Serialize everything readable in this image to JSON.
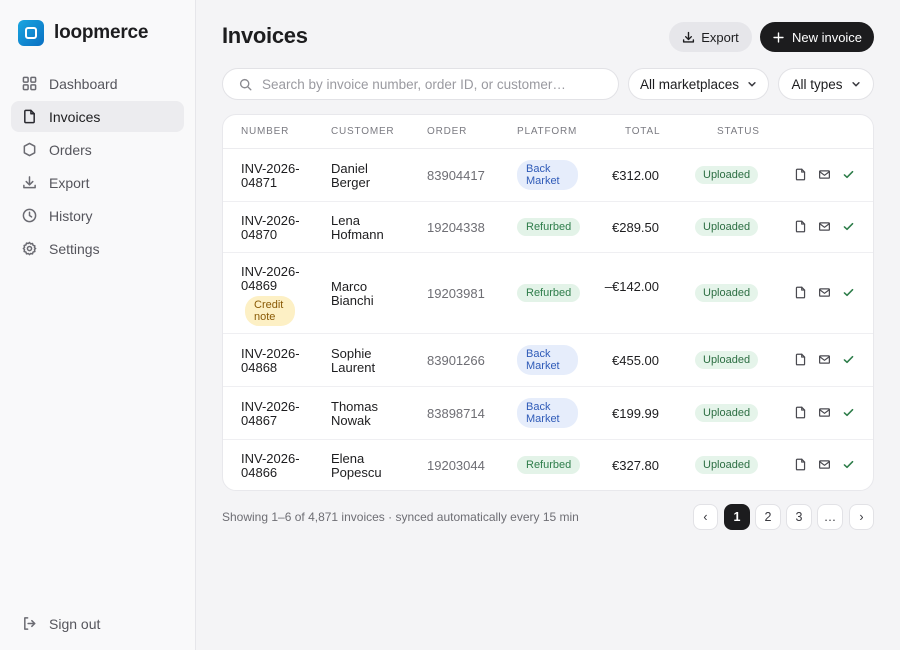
{
  "brand": {
    "name": "loopmerce",
    "logo_icon": "square-logo-icon",
    "logo_color": "#0a8fd6"
  },
  "sidebar": {
    "items": [
      {
        "label": "Dashboard",
        "icon": "grid-icon",
        "active": false
      },
      {
        "label": "Invoices",
        "icon": "file-icon",
        "active": true
      },
      {
        "label": "Orders",
        "icon": "box-icon",
        "active": false
      },
      {
        "label": "Export",
        "icon": "download-icon",
        "active": false
      },
      {
        "label": "History",
        "icon": "clock-icon",
        "active": false
      },
      {
        "label": "Settings",
        "icon": "gear-icon",
        "active": false
      }
    ],
    "signout_label": "Sign out"
  },
  "header": {
    "title": "Invoices",
    "export_label": "Export",
    "new_invoice_label": "New invoice"
  },
  "filters": {
    "search_placeholder": "Search by invoice number, order ID, or customer…",
    "marketplace": "All marketplaces",
    "type": "All types"
  },
  "table": {
    "columns": [
      "Number",
      "Customer",
      "Order",
      "Platform",
      "Total",
      "Status"
    ],
    "rows": [
      {
        "number": "INV-2026-04871",
        "customer": "Daniel Berger",
        "order": "83904417",
        "platform": "Back Market",
        "total": "€312.00",
        "status": "Uploaded",
        "tag": ""
      },
      {
        "number": "INV-2026-04870",
        "customer": "Lena Hofmann",
        "order": "19204338",
        "platform": "Refurbed",
        "total": "€289.50",
        "status": "Uploaded",
        "tag": ""
      },
      {
        "number": "INV-2026-04869",
        "customer": "Marco Bianchi",
        "order": "19203981",
        "platform": "Refurbed",
        "total": "–€142.00",
        "status": "Uploaded",
        "tag": "Credit note"
      },
      {
        "number": "INV-2026-04868",
        "customer": "Sophie Laurent",
        "order": "83901266",
        "platform": "Back Market",
        "total": "€455.00",
        "status": "Uploaded",
        "tag": ""
      },
      {
        "number": "INV-2026-04867",
        "customer": "Thomas Nowak",
        "order": "83898714",
        "platform": "Back Market",
        "total": "€199.99",
        "status": "Uploaded",
        "tag": ""
      },
      {
        "number": "INV-2026-04866",
        "customer": "Elena Popescu",
        "order": "19203044",
        "platform": "Refurbed",
        "total": "€327.80",
        "status": "Uploaded",
        "tag": ""
      }
    ],
    "row_actions": [
      "document-icon",
      "mail-icon",
      "check-icon"
    ]
  },
  "footer": {
    "summary": "Showing 1–6 of 4,871 invoices · synced automatically every 15 min",
    "pages": [
      "‹",
      "1",
      "2",
      "3",
      "…",
      "›"
    ],
    "current_page": "1"
  },
  "colors": {
    "accent_dark": "#1c1c1e",
    "status_uploaded_bg": "#e5f4ea",
    "platform_backmarket_bg": "#e6edfb",
    "platform_refurbed_bg": "#e3f3e8",
    "credit_note_bg": "#fdf0c5"
  }
}
